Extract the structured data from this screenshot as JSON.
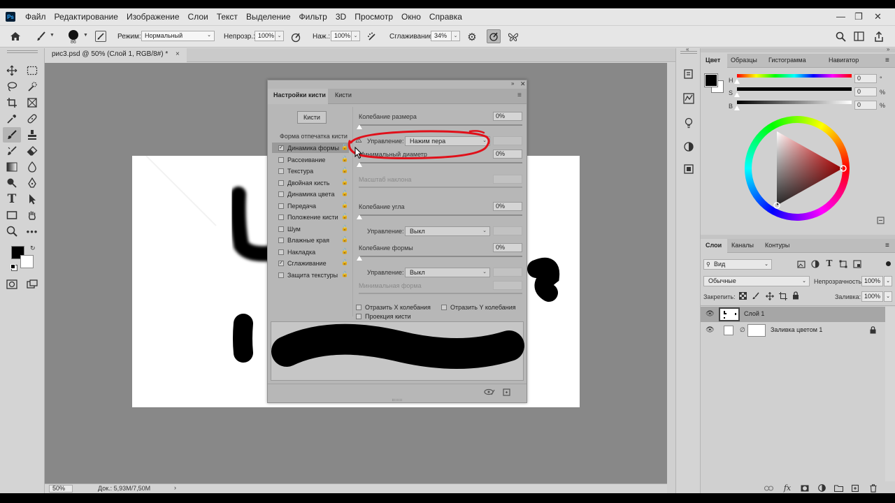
{
  "app": {
    "logo": "Ps"
  },
  "menu": [
    "Файл",
    "Редактирование",
    "Изображение",
    "Слои",
    "Текст",
    "Выделение",
    "Фильтр",
    "3D",
    "Просмотр",
    "Окно",
    "Справка"
  ],
  "options": {
    "brush_size": "86",
    "mode_label": "Режим:",
    "mode_value": "Нормальный",
    "opacity_label": "Непрозр.:",
    "opacity_value": "100%",
    "pressure_label": "Наж.:",
    "pressure_value": "100%",
    "smoothing_label": "Сглаживание:",
    "smoothing_value": "34%"
  },
  "document": {
    "tab_title": "рис3.psd @ 50% (Слой 1, RGB/8#) *",
    "close_glyph": "×",
    "zoom": "50%",
    "doc_info": "Док.: 5,93M/7,50M"
  },
  "brush_panel": {
    "tab_settings": "Настройки кисти",
    "tab_brushes": "Кисти",
    "brushes_button": "Кисти",
    "section_header": "Форма отпечатка кисти",
    "items": [
      {
        "label": "Динамика формы",
        "checked": true
      },
      {
        "label": "Рассеивание",
        "checked": false
      },
      {
        "label": "Текстура",
        "checked": false
      },
      {
        "label": "Двойная кисть",
        "checked": false
      },
      {
        "label": "Динамика цвета",
        "checked": false
      },
      {
        "label": "Передача",
        "checked": false
      },
      {
        "label": "Положение кисти",
        "checked": false
      },
      {
        "label": "Шум",
        "checked": false
      },
      {
        "label": "Влажные края",
        "checked": false
      },
      {
        "label": "Накладка",
        "checked": false
      },
      {
        "label": "Сглаживание",
        "checked": true
      },
      {
        "label": "Защита текстуры",
        "checked": false
      }
    ],
    "size_jitter_label": "Колебание размера",
    "size_jitter_value": "0%",
    "control_label": "Управление:",
    "size_control_value": "Нажим пера",
    "min_diameter_label": "Минимальный диаметр",
    "min_diameter_value": "0%",
    "tilt_scale_label": "Масштаб наклона",
    "angle_jitter_label": "Колебание угла",
    "angle_jitter_value": "0%",
    "angle_control_value": "Выкл",
    "roundness_jitter_label": "Колебание формы",
    "roundness_jitter_value": "0%",
    "roundness_control_value": "Выкл",
    "min_roundness_label": "Минимальная форма",
    "flip_x_label": "Отразить X колебания",
    "flip_y_label": "Отразить Y колебания",
    "brush_projection_label": "Проекция кисти"
  },
  "color_panel": {
    "tabs": [
      "Цвет",
      "Образцы",
      "Гистограмма",
      "Навигатор"
    ],
    "h_label": "H",
    "h_value": "0",
    "s_label": "S",
    "s_value": "0",
    "b_label": "B",
    "b_value": "0",
    "pct": "%"
  },
  "layers_panel": {
    "tabs": [
      "Слои",
      "Каналы",
      "Контуры"
    ],
    "filter_value": "Вид",
    "blend_mode": "Обычные",
    "opacity_label": "Непрозрачность:",
    "opacity_value": "100%",
    "lock_label": "Закрепить:",
    "fill_label": "Заливка:",
    "fill_value": "100%",
    "layers": [
      {
        "name": "Слой 1",
        "selected": true
      },
      {
        "name": "Заливка цветом 1",
        "selected": false
      }
    ]
  },
  "colors": {
    "accent_red": "#e0101a",
    "foreground": "#000000",
    "background": "#ffffff"
  }
}
